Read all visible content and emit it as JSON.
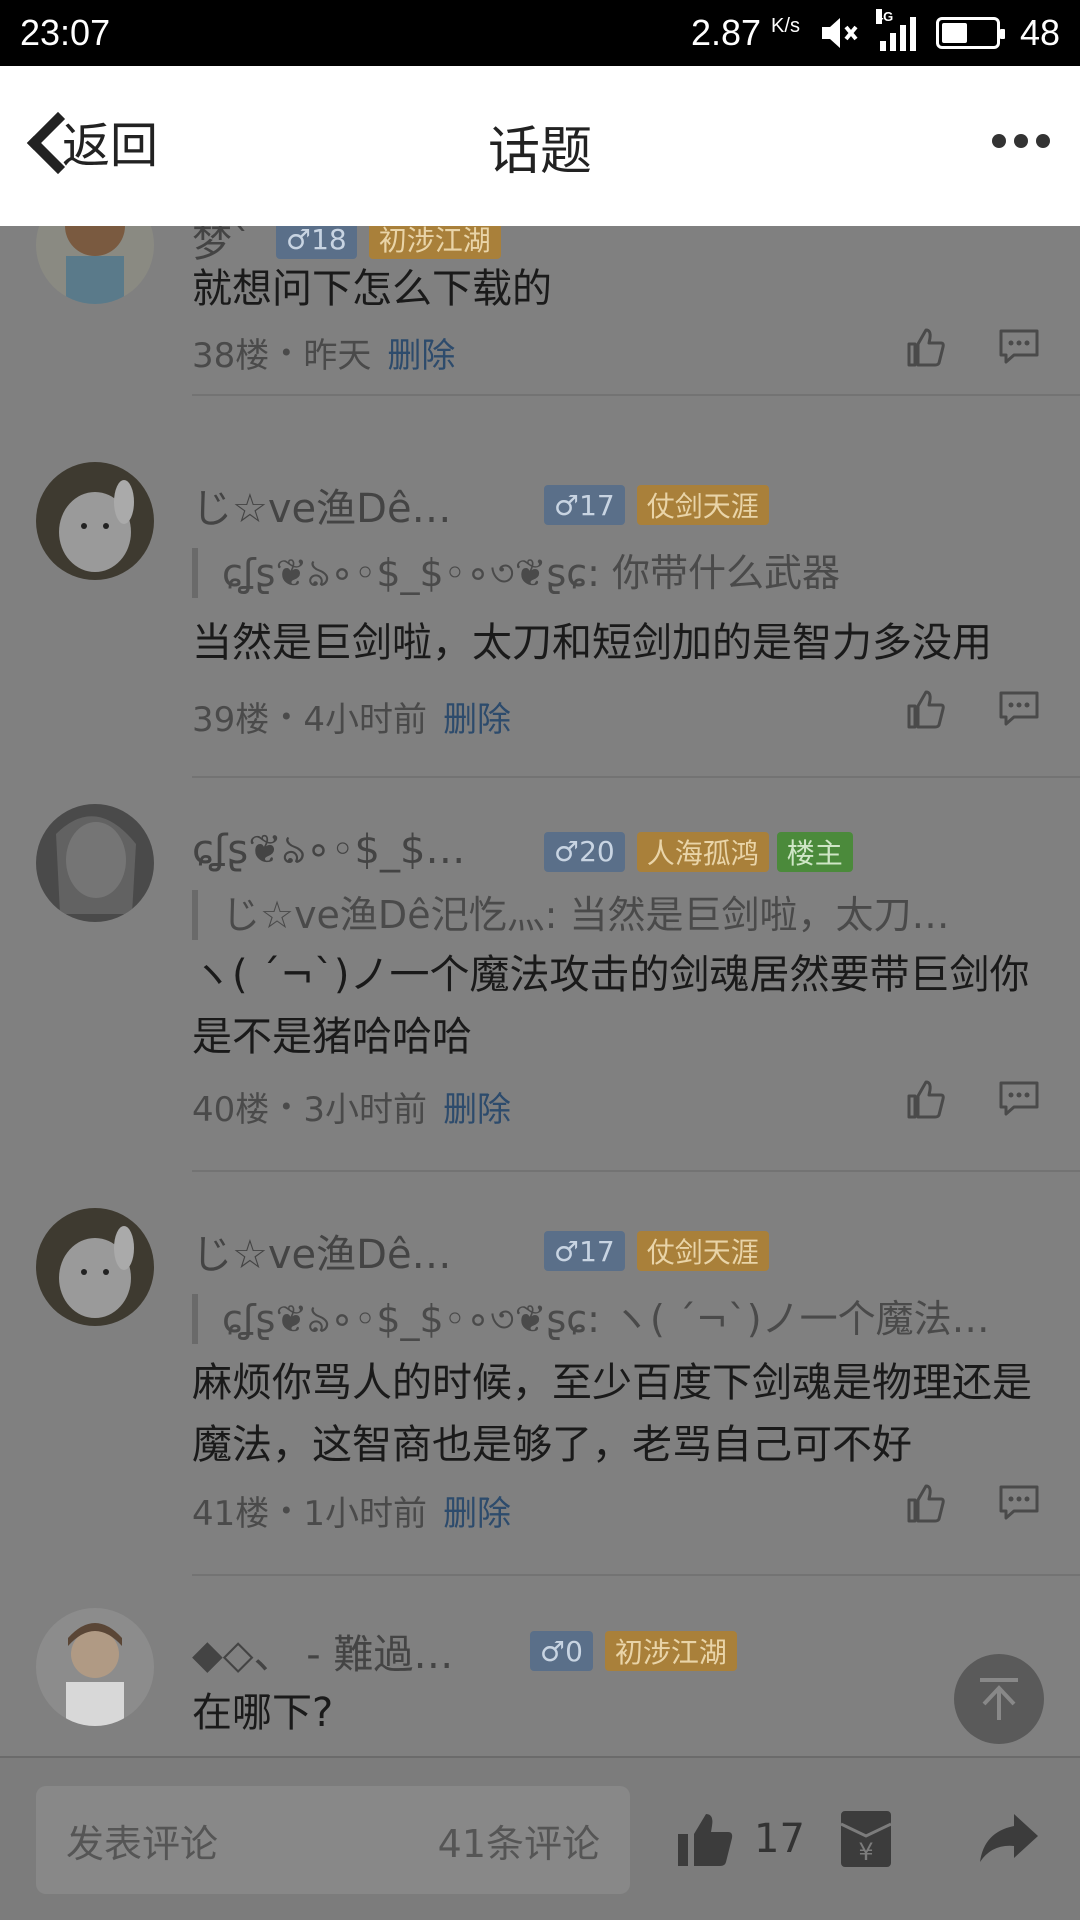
{
  "status_bar": {
    "time": "23:07",
    "speed": "2.87",
    "speed_unit": "K/s",
    "network": "4G",
    "battery": "48",
    "battery_level": 0.48
  },
  "header": {
    "back_label": "返回",
    "title": "话题"
  },
  "comments": [
    {
      "name": "梦`",
      "gender_badge": "♂18",
      "level_badge": "初涉江湖",
      "text": "就想问下怎么下载的",
      "floor": "38楼",
      "time": "昨天",
      "delete_label": "删除"
    },
    {
      "name": "じ☆ve渔Dê…",
      "gender_badge": "♂17",
      "level_badge": "仗剑天涯",
      "quote": "ɕʆʂ❦ঌ∘◦$_$◦∘৩❦ʂɕ: 你带什么武器",
      "text": "当然是巨剑啦，太刀和短剑加的是智力多没用",
      "floor": "39楼",
      "time": "4小时前",
      "delete_label": "删除"
    },
    {
      "name": "ɕʆʂ❦ঌ∘◦$_$…",
      "gender_badge": "♂20",
      "level_badge": "人海孤鸿",
      "owner_badge": "楼主",
      "quote": "じ☆ve渔Dê汜忔灬: 当然是巨剑啦，太刀…",
      "text": "ヽ( ´¬`)ノ一个魔法攻击的剑魂居然要带巨剑你是不是猪哈哈哈",
      "floor": "40楼",
      "time": "3小时前",
      "delete_label": "删除"
    },
    {
      "name": "じ☆ve渔Dê…",
      "gender_badge": "♂17",
      "level_badge": "仗剑天涯",
      "quote": "ɕʆʂ❦ঌ∘◦$_$◦∘৩❦ʂɕ: ヽ( ´¬`)ノ一个魔法…",
      "text": "麻烦你骂人的时候，至少百度下剑魂是物理还是魔法，这智商也是够了，老骂自己可不好",
      "floor": "41楼",
      "time": "1小时前",
      "delete_label": "删除"
    },
    {
      "name": "◆◇、 - 難過…",
      "gender_badge": "♂0",
      "level_badge": "初涉江湖",
      "text": "在哪下?"
    }
  ],
  "bottom_bar": {
    "input_placeholder": "发表评论",
    "comment_count": "41条评论",
    "like_count": "17"
  },
  "icons": {
    "back": "chevron-left-icon",
    "more": "more-dots-icon",
    "like": "thumbs-up-icon",
    "reply": "comment-bubble-icon",
    "scroll_top": "arrow-up-icon",
    "gift": "red-envelope-icon",
    "share": "share-arrow-icon"
  },
  "colors": {
    "link": "#2d4b6c",
    "gender_badge": "#5a6f89",
    "level_badge": "#a9803a",
    "owner_badge": "#4b8a3b"
  }
}
